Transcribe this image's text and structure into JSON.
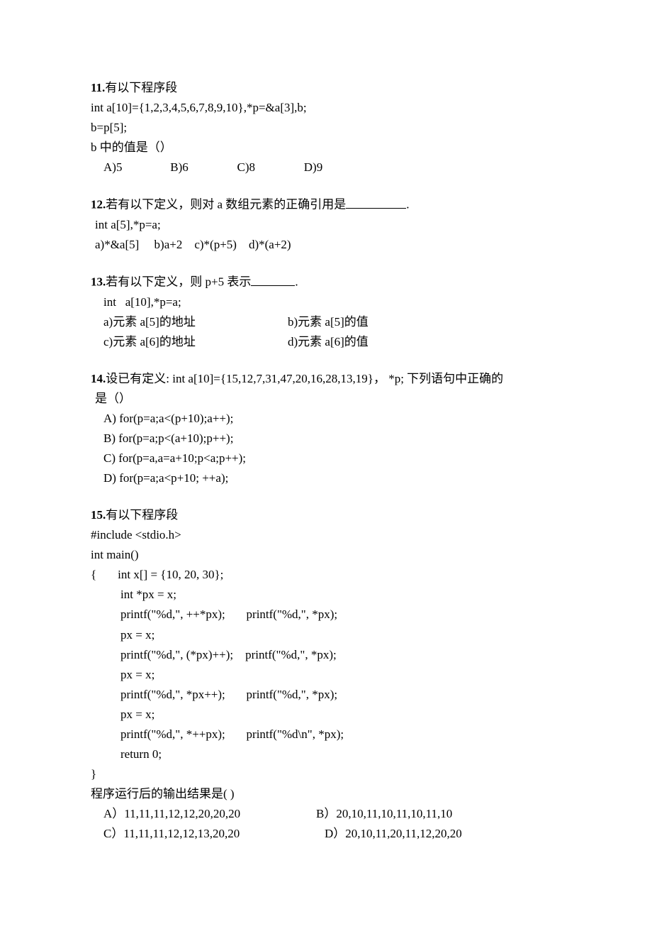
{
  "q11": {
    "num": "11.",
    "title": "有以下程序段",
    "l1": "int a[10]={1,2,3,4,5,6,7,8,9,10},*p=&a[3],b;",
    "l2": "b=p[5];",
    "l3": "b 中的值是（）",
    "optA": "A)5",
    "optB": "B)6",
    "optC": "C)8",
    "optD": "D)9"
  },
  "q12": {
    "num": "12.",
    "title_a": "若有以下定义，则对 a 数组元素的正确引用是",
    "title_b": ".",
    "l1": "int a[5],*p=a;",
    "opts": "a)*&a[5]     b)a+2    c)*(p+5)    d)*(a+2)"
  },
  "q13": {
    "num": "13.",
    "title_a": "若有以下定义，则 p+5 表示",
    "title_b": ".",
    "l1": "int   a[10],*p=a;",
    "optA": "a)元素 a[5]的地址",
    "optB": "b)元素 a[5]的值",
    "optC": "c)元素 a[6]的地址",
    "optD": "d)元素 a[6]的值"
  },
  "q14": {
    "num": "14.",
    "title_a": "设已有定义: int a[10]={15,12,7,31,47,20,16,28,13,19}， *p;  下列语句中正确的",
    "title_b": "是（）",
    "optA": "A) for(p=a;a<(p+10);a++);",
    "optB": "B) for(p=a;p<(a+10);p++);",
    "optC": "C) for(p=a,a=a+10;p<a;p++);",
    "optD": "D) for(p=a;a<p+10; ++a);"
  },
  "q15": {
    "num": "15.",
    "title": "有以下程序段",
    "c0": "#include <stdio.h>",
    "c1": "int main()",
    "c2a": "{",
    "c2b": "int x[] = {10, 20, 30};",
    "c3": "int *px = x;",
    "c4": "printf(\"%d,\", ++*px);       printf(\"%d,\", *px);",
    "c5": "px = x;",
    "c6": "printf(\"%d,\", (*px)++);    printf(\"%d,\", *px);",
    "c7": "px = x;",
    "c8": "printf(\"%d,\", *px++);       printf(\"%d,\", *px);",
    "c9": "px = x;",
    "c10": "printf(\"%d,\", *++px);       printf(\"%d\\n\", *px);",
    "c11": "return 0;",
    "c12": "}",
    "result": "程序运行后的输出结果是( )",
    "optA": "A）11,11,11,12,12,20,20,20",
    "optB": "B）20,10,11,10,11,10,11,10",
    "optC": "C）11,11,11,12,12,13,20,20",
    "optD": "D）20,10,11,20,11,12,20,20"
  }
}
